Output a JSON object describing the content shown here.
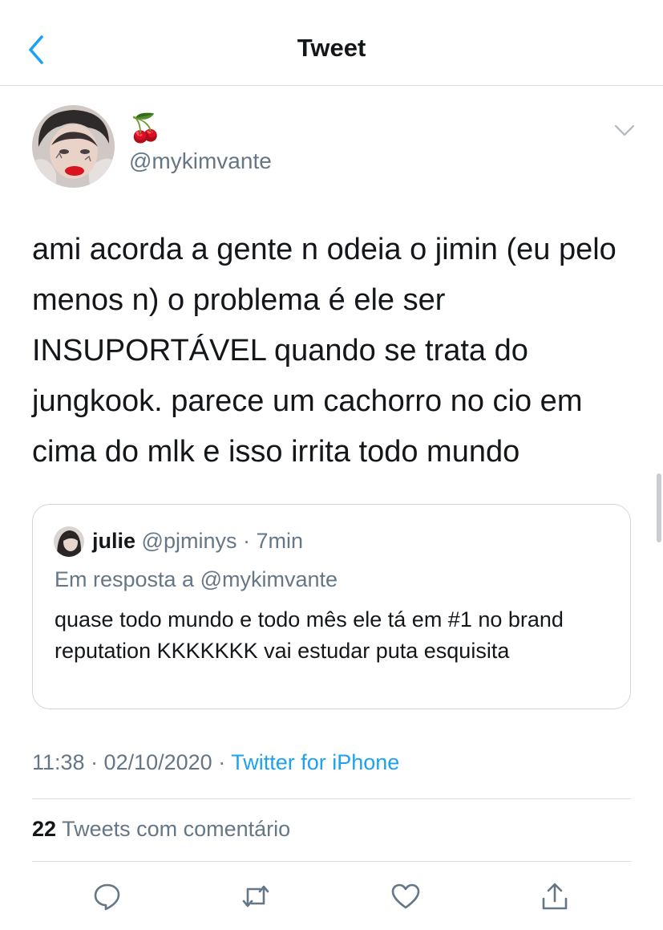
{
  "nav": {
    "title": "Tweet"
  },
  "tweet": {
    "author_name": "🍒",
    "handle": "@mykimvante",
    "text": "ami acorda a gente n odeia o jimin (eu pelo menos n) o problema é ele ser INSUPORTÁVEL quando se trata do jungkook. parece um cachorro no cio em cima do mlk e isso irrita todo mundo",
    "time": "11:38 · 02/10/2020 ·",
    "source": "Twitter for iPhone",
    "comment_count": "22",
    "comment_label": "Tweets com comentário"
  },
  "quoted": {
    "name": "julie",
    "handle": "@pjminys",
    "age": "· 7min",
    "reply_to": "Em resposta a @mykimvante",
    "text": "quase todo mundo e todo mês ele tá em #1 no brand reputation KKKKKKK vai estudar puta esquisita"
  },
  "colors": {
    "accent": "#1da1f2",
    "muted": "#657786",
    "text": "#14171a",
    "border": "#d9dde1"
  },
  "icons": [
    "back-chevron-icon",
    "caret-down-icon",
    "reply-icon",
    "retweet-icon",
    "like-icon",
    "share-icon"
  ]
}
